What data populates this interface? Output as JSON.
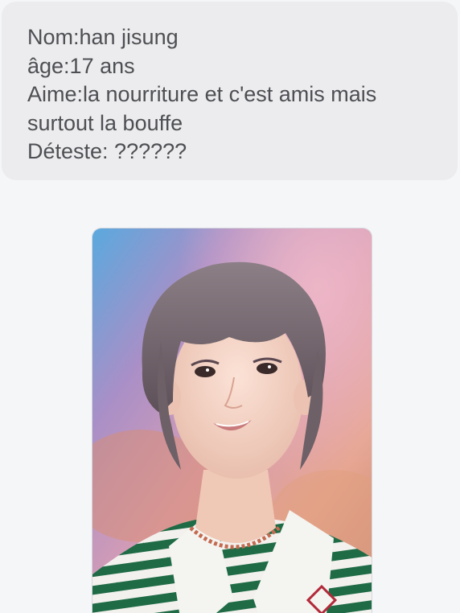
{
  "message": {
    "lines": [
      "Nom:han jisung",
      "âge:17 ans",
      "Aime:la nourriture et c'est amis mais",
      "surtout la bouffe",
      "Déteste: ??????"
    ]
  },
  "photo": {
    "subject": "portrait-photo"
  }
}
